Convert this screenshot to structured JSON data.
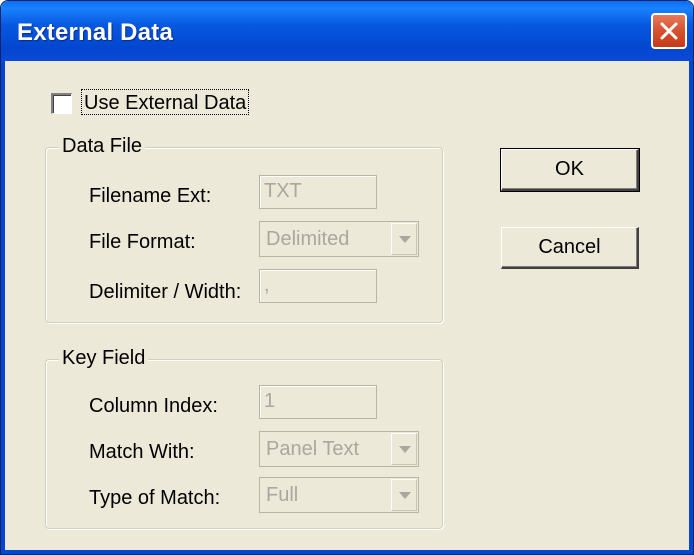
{
  "window": {
    "title": "External Data"
  },
  "use_external": {
    "label": "Use External Data",
    "checked": false
  },
  "data_file": {
    "group_title": "Data File",
    "filename_ext": {
      "label": "Filename Ext:",
      "value": "TXT"
    },
    "file_format": {
      "label": "File Format:",
      "value": "Delimited"
    },
    "delimiter": {
      "label": "Delimiter / Width:",
      "value": ","
    }
  },
  "key_field": {
    "group_title": "Key Field",
    "column_index": {
      "label": "Column Index:",
      "value": "1"
    },
    "match_with": {
      "label": "Match With:",
      "value": "Panel Text"
    },
    "type_of_match": {
      "label": "Type of Match:",
      "value": "Full"
    }
  },
  "buttons": {
    "ok": "OK",
    "cancel": "Cancel"
  },
  "colors": {
    "titlebar": "#0346cf",
    "dialog_bg": "#ece9d8",
    "disabled_text": "#a9a7a0",
    "close_button": "#d6512f"
  },
  "icons": {
    "close": "close-icon",
    "dropdown": "chevron-down-icon"
  }
}
